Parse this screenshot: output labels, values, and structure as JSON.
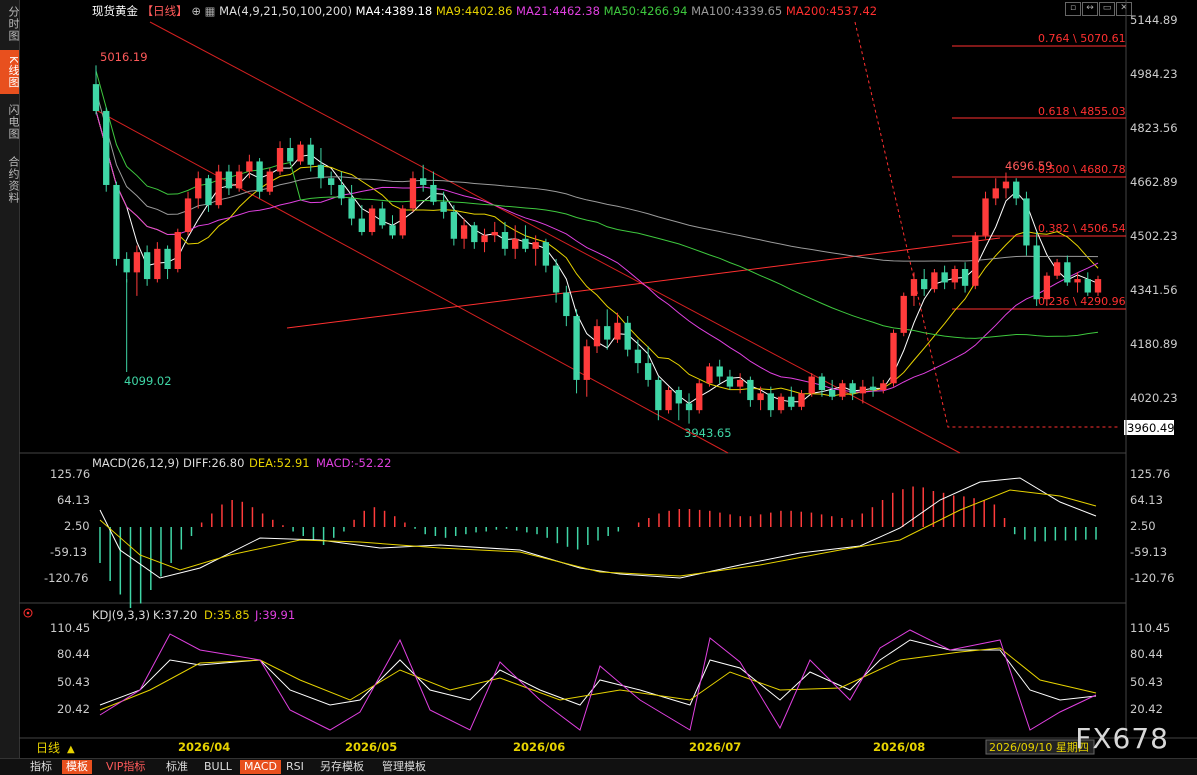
{
  "sidebar": {
    "tabs": [
      "分时图",
      "K线图",
      "闪电图",
      "合约资料"
    ],
    "active": 1
  },
  "header": {
    "instrument": "现货黄金",
    "period": "【日线】",
    "ma_title": "MA(4,9,21,50,100,200)",
    "ma_values": [
      {
        "label": "MA4:4389.18",
        "color": "#ffffff"
      },
      {
        "label": "MA9:4402.86",
        "color": "#e6d200"
      },
      {
        "label": "MA21:4462.38",
        "color": "#e040e0"
      },
      {
        "label": "MA50:4266.94",
        "color": "#3ec83e"
      },
      {
        "label": "MA100:4339.65",
        "color": "#9a9a9a"
      },
      {
        "label": "MA200:4537.42",
        "color": "#ff3030"
      }
    ]
  },
  "window_buttons": [
    "▫",
    "↔",
    "▭",
    "✕"
  ],
  "price_axis": [
    "5144.89",
    "4984.23",
    "4823.56",
    "4662.89",
    "4502.23",
    "4341.56",
    "4180.89",
    "4020.23"
  ],
  "price_marker": "3960.49",
  "annotations": {
    "high": "5016.19",
    "low1": "4099.02",
    "low2": "3943.65",
    "peak": "4696.59"
  },
  "fib_levels": [
    {
      "label": "0.764 \\ 5070.61"
    },
    {
      "label": "0.618 \\ 4855.03"
    },
    {
      "label": "0.500 \\ 4680.78"
    },
    {
      "label": "0.382 \\ 4506.54"
    },
    {
      "label": "0.236 \\ 4290.96"
    }
  ],
  "macd": {
    "title": "MACD(26,12,9)",
    "diff": "DIFF:26.80",
    "dea": "DEA:52.91",
    "macd": "MACD:-52.22",
    "axis": [
      "125.76",
      "64.13",
      "2.50",
      "-59.13",
      "-120.76"
    ]
  },
  "kdj": {
    "title": "KDJ(9,3,3)",
    "k": "K:37.20",
    "d": "D:35.85",
    "j": "J:39.91",
    "axis": [
      "110.45",
      "80.44",
      "50.43",
      "20.42"
    ]
  },
  "time_axis": [
    "2026/04",
    "2026/05",
    "2026/06",
    "2026/07",
    "2026/08"
  ],
  "cursor_date": "2026/09/10 星期四",
  "period_label": "日线",
  "toolbar": [
    "指标",
    "模板",
    "VIP指标",
    "标准",
    "BULL",
    "MACD",
    "RSI",
    "另存模板",
    "管理模板"
  ],
  "watermark": "FX678",
  "colors": {
    "up": "#ff3b3b",
    "down": "#3fd6a6",
    "ma4": "#ffffff",
    "ma9": "#e6d200",
    "ma21": "#e040e0",
    "ma50": "#3ec83e",
    "ma100": "#9a9a9a",
    "ma200": "#ff3030",
    "channel": "#d42020"
  },
  "chart_data": {
    "type": "candlestick",
    "ylim": [
      3880,
      5200
    ],
    "candles_ohlc": [
      [
        4960,
        5016,
        4870,
        4880
      ],
      [
        4880,
        4890,
        4640,
        4660
      ],
      [
        4660,
        4670,
        4420,
        4440
      ],
      [
        4440,
        4460,
        4370,
        4400
      ],
      [
        4400,
        4480,
        4330,
        4460
      ],
      [
        4460,
        4480,
        4360,
        4380
      ],
      [
        4380,
        4490,
        4370,
        4470
      ],
      [
        4470,
        4480,
        4380,
        4410
      ],
      [
        4410,
        4530,
        4400,
        4520
      ],
      [
        4520,
        4640,
        4510,
        4620
      ],
      [
        4620,
        4700,
        4590,
        4680
      ],
      [
        4680,
        4690,
        4580,
        4600
      ],
      [
        4600,
        4720,
        4590,
        4700
      ],
      [
        4700,
        4720,
        4630,
        4650
      ],
      [
        4650,
        4720,
        4640,
        4700
      ],
      [
        4700,
        4750,
        4680,
        4730
      ],
      [
        4730,
        4740,
        4620,
        4640
      ],
      [
        4640,
        4710,
        4630,
        4700
      ],
      [
        4700,
        4790,
        4690,
        4770
      ],
      [
        4770,
        4800,
        4720,
        4730
      ],
      [
        4730,
        4790,
        4720,
        4780
      ],
      [
        4780,
        4800,
        4700,
        4720
      ],
      [
        4720,
        4770,
        4650,
        4680
      ],
      [
        4680,
        4700,
        4630,
        4660
      ],
      [
        4660,
        4700,
        4600,
        4620
      ],
      [
        4620,
        4660,
        4540,
        4560
      ],
      [
        4560,
        4600,
        4510,
        4520
      ],
      [
        4520,
        4600,
        4510,
        4590
      ],
      [
        4590,
        4610,
        4530,
        4540
      ],
      [
        4540,
        4570,
        4500,
        4510
      ],
      [
        4510,
        4600,
        4500,
        4590
      ],
      [
        4590,
        4700,
        4580,
        4680
      ],
      [
        4680,
        4720,
        4640,
        4660
      ],
      [
        4660,
        4700,
        4600,
        4610
      ],
      [
        4610,
        4640,
        4560,
        4580
      ],
      [
        4580,
        4600,
        4480,
        4500
      ],
      [
        4500,
        4560,
        4470,
        4540
      ],
      [
        4540,
        4550,
        4470,
        4490
      ],
      [
        4490,
        4530,
        4460,
        4510
      ],
      [
        4510,
        4550,
        4490,
        4520
      ],
      [
        4520,
        4550,
        4450,
        4470
      ],
      [
        4470,
        4540,
        4440,
        4500
      ],
      [
        4500,
        4540,
        4460,
        4470
      ],
      [
        4470,
        4510,
        4420,
        4490
      ],
      [
        4490,
        4500,
        4400,
        4420
      ],
      [
        4420,
        4440,
        4310,
        4340
      ],
      [
        4340,
        4360,
        4240,
        4270
      ],
      [
        4270,
        4290,
        4040,
        4080
      ],
      [
        4080,
        4200,
        4030,
        4180
      ],
      [
        4180,
        4260,
        4160,
        4240
      ],
      [
        4240,
        4290,
        4170,
        4200
      ],
      [
        4200,
        4280,
        4190,
        4250
      ],
      [
        4250,
        4270,
        4150,
        4170
      ],
      [
        4170,
        4200,
        4100,
        4130
      ],
      [
        4130,
        4180,
        4060,
        4080
      ],
      [
        4080,
        4090,
        3960,
        3990
      ],
      [
        3990,
        4060,
        3980,
        4050
      ],
      [
        4050,
        4060,
        3960,
        4010
      ],
      [
        4010,
        4040,
        3950,
        3990
      ],
      [
        3990,
        4080,
        3980,
        4070
      ],
      [
        4070,
        4130,
        4060,
        4120
      ],
      [
        4120,
        4140,
        4070,
        4090
      ],
      [
        4090,
        4110,
        4050,
        4060
      ],
      [
        4060,
        4100,
        4040,
        4080
      ],
      [
        4080,
        4090,
        4000,
        4020
      ],
      [
        4020,
        4060,
        3990,
        4040
      ],
      [
        4040,
        4060,
        3970,
        3990
      ],
      [
        3990,
        4040,
        3980,
        4030
      ],
      [
        4030,
        4060,
        3990,
        4000
      ],
      [
        4000,
        4050,
        3990,
        4040
      ],
      [
        4040,
        4100,
        4030,
        4090
      ],
      [
        4090,
        4100,
        4030,
        4050
      ],
      [
        4050,
        4080,
        4020,
        4030
      ],
      [
        4030,
        4080,
        4020,
        4070
      ],
      [
        4070,
        4080,
        4020,
        4040
      ],
      [
        4040,
        4080,
        4010,
        4060
      ],
      [
        4060,
        4090,
        4030,
        4050
      ],
      [
        4050,
        4080,
        4040,
        4070
      ],
      [
        4070,
        4230,
        4060,
        4220
      ],
      [
        4220,
        4340,
        4210,
        4330
      ],
      [
        4330,
        4400,
        4300,
        4380
      ],
      [
        4380,
        4410,
        4330,
        4350
      ],
      [
        4350,
        4410,
        4340,
        4400
      ],
      [
        4400,
        4420,
        4350,
        4370
      ],
      [
        4370,
        4420,
        4350,
        4410
      ],
      [
        4410,
        4430,
        4340,
        4360
      ],
      [
        4360,
        4520,
        4350,
        4510
      ],
      [
        4510,
        4640,
        4500,
        4620
      ],
      [
        4620,
        4680,
        4600,
        4650
      ],
      [
        4650,
        4697,
        4620,
        4670
      ],
      [
        4670,
        4680,
        4600,
        4620
      ],
      [
        4620,
        4640,
        4450,
        4480
      ],
      [
        4480,
        4520,
        4300,
        4320
      ],
      [
        4320,
        4400,
        4300,
        4390
      ],
      [
        4390,
        4440,
        4380,
        4430
      ],
      [
        4430,
        4450,
        4360,
        4370
      ],
      [
        4370,
        4400,
        4340,
        4380
      ],
      [
        4380,
        4400,
        4330,
        4340
      ],
      [
        4340,
        4390,
        4330,
        4380
      ]
    ]
  }
}
